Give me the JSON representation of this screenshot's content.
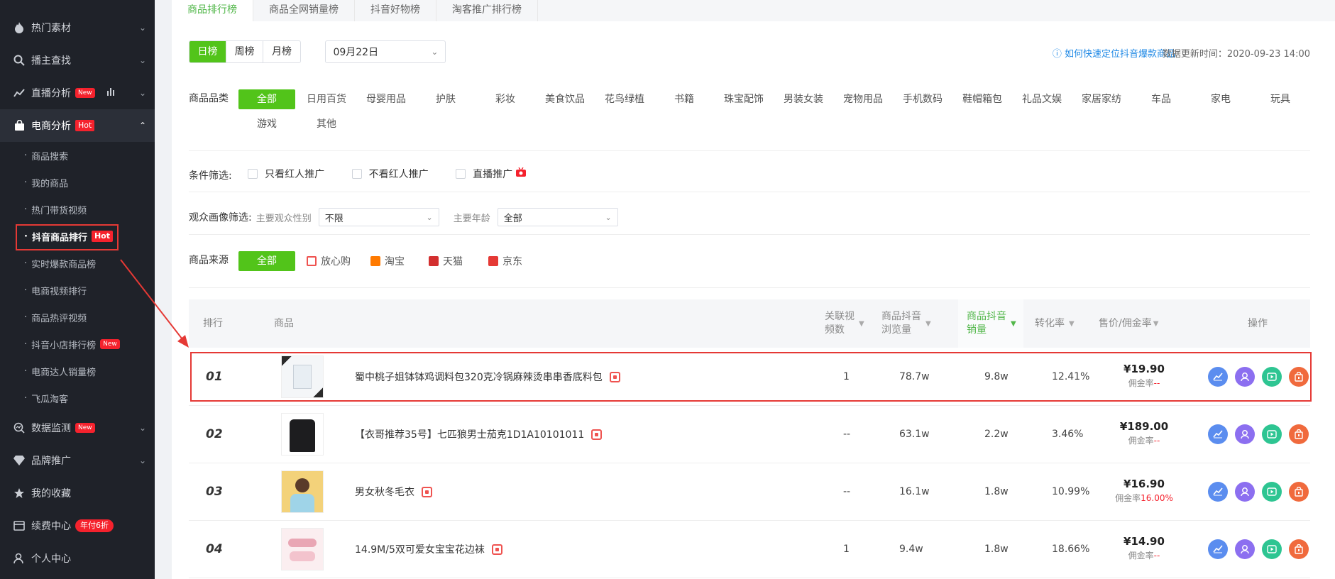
{
  "sidebar": {
    "items": [
      {
        "label": "热门素材",
        "icon": "fire-icon"
      },
      {
        "label": "播主查找",
        "icon": "search-icon"
      },
      {
        "label": "直播分析",
        "icon": "chart-line-icon",
        "badge": "New"
      },
      {
        "label": "电商分析",
        "icon": "shopping-bag-icon",
        "badge": "Hot"
      }
    ],
    "sub_items": [
      {
        "label": "商品搜索"
      },
      {
        "label": "我的商品"
      },
      {
        "label": "热门带货视频"
      },
      {
        "label": "抖音商品排行",
        "badge": "Hot"
      },
      {
        "label": "实时爆款商品榜"
      },
      {
        "label": "电商视频排行"
      },
      {
        "label": "商品热评视频"
      },
      {
        "label": "抖音小店排行榜",
        "badge": "New"
      },
      {
        "label": "电商达人销量榜"
      },
      {
        "label": "飞瓜淘客"
      }
    ],
    "bottom_items": [
      {
        "label": "数据监测",
        "icon": "monitor-icon",
        "badge": "New"
      },
      {
        "label": "品牌推广",
        "icon": "diamond-icon"
      },
      {
        "label": "我的收藏",
        "icon": "star-icon"
      },
      {
        "label": "续费中心",
        "icon": "wallet-icon",
        "badge": "年付6折"
      },
      {
        "label": "个人中心",
        "icon": "user-icon"
      }
    ]
  },
  "tabs": [
    "商品排行榜",
    "商品全网销量榜",
    "抖音好物榜",
    "淘客推广排行榜"
  ],
  "period": {
    "options": [
      "日榜",
      "周榜",
      "月榜"
    ],
    "selected": "日榜",
    "date": "09月22日"
  },
  "help_link": "如何快速定位抖音爆款商品",
  "update_time": "数据更新时间：2020-09-23 14:00",
  "category": {
    "label": "商品品类",
    "options": [
      "全部",
      "日用百货",
      "母婴用品",
      "护肤",
      "彩妆",
      "美食饮品",
      "花鸟绿植",
      "书籍",
      "珠宝配饰",
      "男装女装",
      "宠物用品",
      "手机数码",
      "鞋帽箱包",
      "礼品文娱",
      "家居家纺",
      "车品",
      "家电",
      "玩具",
      "游戏",
      "其他"
    ],
    "selected": "全部"
  },
  "conditions": {
    "label": "条件筛选:",
    "options": [
      "只看红人推广",
      "不看红人推广",
      "直播推广"
    ]
  },
  "audience": {
    "label": "观众画像筛选:",
    "gender_label": "主要观众性别",
    "gender_value": "不限",
    "age_label": "主要年龄",
    "age_value": "全部"
  },
  "source": {
    "label": "商品来源",
    "options": [
      {
        "label": "全部"
      },
      {
        "label": "放心购",
        "color": "#ef5350"
      },
      {
        "label": "淘宝",
        "color": "#ff7a00"
      },
      {
        "label": "天猫",
        "color": "#d32f2f"
      },
      {
        "label": "京东",
        "color": "#e53935"
      }
    ]
  },
  "table": {
    "headers": {
      "rank": "排行",
      "product": "商品",
      "videos": [
        "关联视",
        "频数"
      ],
      "views": [
        "商品抖音",
        "浏览量"
      ],
      "sales": [
        "商品抖音",
        "销量"
      ],
      "conversion": "转化率",
      "price": "售价/佣金率",
      "ops": "操作"
    },
    "rows": [
      {
        "rank": "01",
        "name": "蜀中桃子姐钵钵鸡调料包320克冷锅麻辣烫串串香底料包",
        "videos": "1",
        "views": "78.7w",
        "sales": "9.8w",
        "conversion": "12.41%",
        "price": "¥19.90",
        "commission_label": "佣金率",
        "commission": "--"
      },
      {
        "rank": "02",
        "name": "【衣哥推荐35号】七匹狼男士茄克1D1A10101011",
        "videos": "--",
        "views": "63.1w",
        "sales": "2.2w",
        "conversion": "3.46%",
        "price": "¥189.00",
        "commission_label": "佣金率",
        "commission": "--"
      },
      {
        "rank": "03",
        "name": "男女秋冬毛衣",
        "videos": "--",
        "views": "16.1w",
        "sales": "1.8w",
        "conversion": "10.99%",
        "price": "¥16.90",
        "commission_label": "佣金率",
        "commission": "16.00%"
      },
      {
        "rank": "04",
        "name": "14.9M/5双可爱女宝宝花边袜",
        "videos": "1",
        "views": "9.4w",
        "sales": "1.8w",
        "conversion": "18.66%",
        "price": "¥14.90",
        "commission_label": "佣金率",
        "commission": "--"
      }
    ]
  }
}
